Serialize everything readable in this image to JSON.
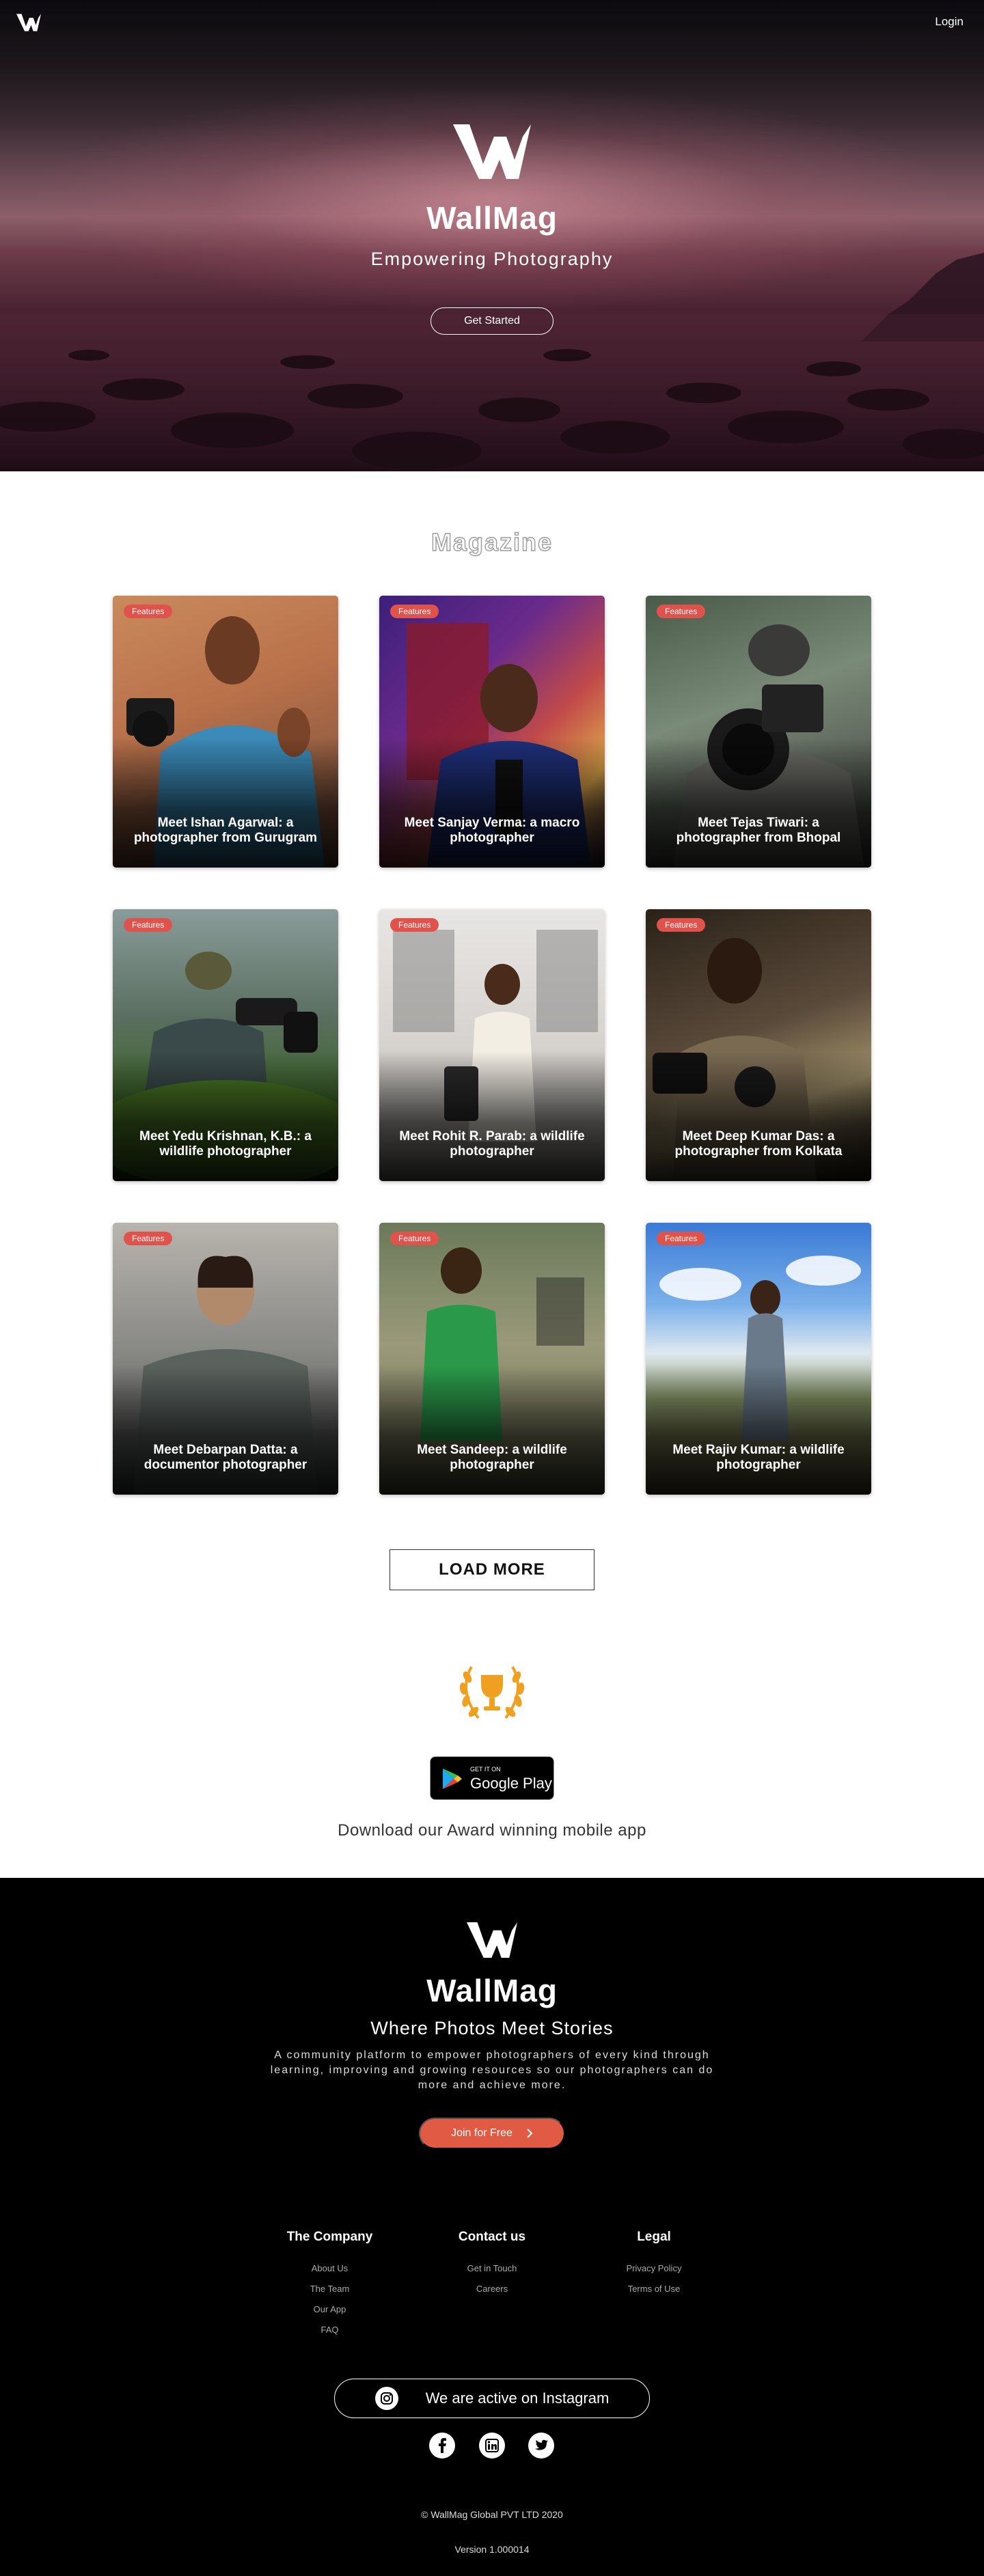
{
  "header": {
    "login_label": "Login",
    "brand": "WallMag",
    "tagline": "Empowering Photography",
    "cta_label": "Get Started"
  },
  "magazine": {
    "title": "Magazine",
    "cards": [
      {
        "badge": "Features",
        "caption": "Meet Ishan Agarwal: a photographer from Gurugram"
      },
      {
        "badge": "Features",
        "caption": "Meet Sanjay Verma: a macro photographer"
      },
      {
        "badge": "Features",
        "caption": "Meet Tejas Tiwari: a photographer from Bhopal"
      },
      {
        "badge": "Features",
        "caption": "Meet Yedu Krishnan, K.B.: a wildlife photographer"
      },
      {
        "badge": "Features",
        "caption": "Meet Rohit R. Parab: a wildlife photographer"
      },
      {
        "badge": "Features",
        "caption": "Meet Deep Kumar Das: a photographer from Kolkata"
      },
      {
        "badge": "Features",
        "caption": "Meet Debarpan Datta: a documentor photographer"
      },
      {
        "badge": "Features",
        "caption": "Meet Sandeep: a wildlife photographer"
      },
      {
        "badge": "Features",
        "caption": "Meet Rajiv Kumar: a wildlife photographer"
      }
    ],
    "load_more_label": "LOAD MORE"
  },
  "app": {
    "store_small": "GET IT ON",
    "store_big": "Google Play",
    "download_text": "Download our Award winning mobile app"
  },
  "footer": {
    "brand": "WallMag",
    "subtitle": "Where Photos Meet Stories",
    "description": "A community platform to empower photographers of every kind through learning, improving and growing resources so our photographers can do more and achieve more.",
    "join_label": "Join for Free",
    "columns": [
      {
        "heading": "The Company",
        "links": [
          "About Us",
          "The Team",
          "Our App",
          "FAQ"
        ]
      },
      {
        "heading": "Contact us",
        "links": [
          "Get in Touch",
          "Careers"
        ]
      },
      {
        "heading": "Legal",
        "links": [
          "Privacy Policy",
          "Terms of Use"
        ]
      }
    ],
    "instagram_label": "We are active on Instagram",
    "social": [
      "facebook-icon",
      "linkedin-icon",
      "twitter-icon"
    ],
    "copyright": "© WallMag Global PVT LTD 2020",
    "version": "Version 1.000014"
  },
  "colors": {
    "accent": "#e05a44",
    "badge": "#e0534c",
    "footer_bg": "#000000",
    "trophy": "#f0a020"
  }
}
